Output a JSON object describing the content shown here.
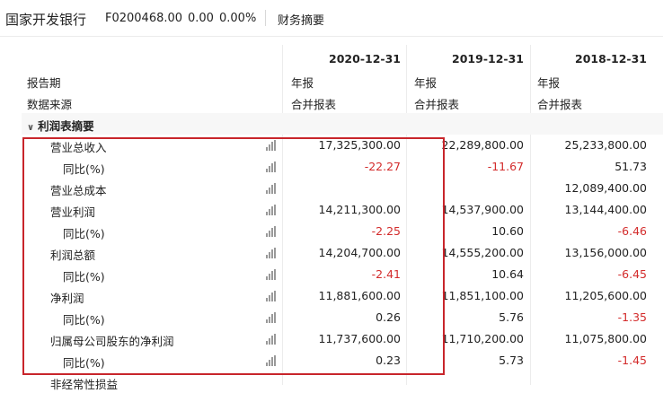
{
  "header": {
    "company_name": "国家开发银行",
    "code": "F0200468.00",
    "change": "0.00",
    "change_pct": "0.00%",
    "tab_label": "财务摘要"
  },
  "columns": [
    "2020-12-31",
    "2019-12-31",
    "2018-12-31"
  ],
  "meta_rows": [
    {
      "label": "报告期",
      "values": [
        "年报",
        "年报",
        "年报"
      ]
    },
    {
      "label": "数据来源",
      "values": [
        "合并报表",
        "合并报表",
        "合并报表"
      ]
    }
  ],
  "section": {
    "label": "利润表摘要"
  },
  "rows": [
    {
      "label": "营业总收入",
      "values": [
        "17,325,300.00",
        "22,289,800.00",
        "25,233,800.00"
      ]
    },
    {
      "label": "同比(%)",
      "values": [
        "-22.27",
        "-11.67",
        "51.73"
      ]
    },
    {
      "label": "营业总成本",
      "values": [
        "",
        "",
        "12,089,400.00"
      ]
    },
    {
      "label": "营业利润",
      "values": [
        "14,211,300.00",
        "14,537,900.00",
        "13,144,400.00"
      ]
    },
    {
      "label": "同比(%)",
      "values": [
        "-2.25",
        "10.60",
        "-6.46"
      ]
    },
    {
      "label": "利润总额",
      "values": [
        "14,204,700.00",
        "14,555,200.00",
        "13,156,000.00"
      ]
    },
    {
      "label": "同比(%)",
      "values": [
        "-2.41",
        "10.64",
        "-6.45"
      ]
    },
    {
      "label": "净利润",
      "values": [
        "11,881,600.00",
        "11,851,100.00",
        "11,205,600.00"
      ]
    },
    {
      "label": "同比(%)",
      "values": [
        "0.26",
        "5.76",
        "-1.35"
      ]
    },
    {
      "label": "归属母公司股东的净利润",
      "values": [
        "11,737,600.00",
        "11,710,200.00",
        "11,075,800.00"
      ]
    },
    {
      "label": "同比(%)",
      "values": [
        "0.23",
        "5.73",
        "-1.45"
      ]
    },
    {
      "label": "非经常性损益",
      "values": [
        "",
        "",
        ""
      ]
    }
  ],
  "colors": {
    "negative": "#d32b2b",
    "highlight_box": "#c8252b"
  }
}
